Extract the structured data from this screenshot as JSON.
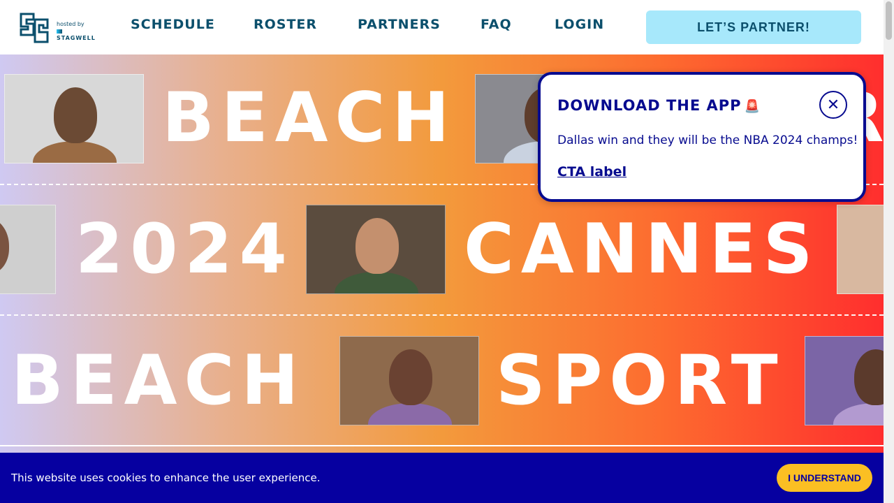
{
  "header": {
    "logo_alt": "SB",
    "hosted_by": "hosted by",
    "sponsor": "STAGWELL",
    "nav": [
      "SCHEDULE",
      "ROSTER",
      "PARTNERS",
      "FAQ",
      "LOGIN"
    ],
    "cta": "LET’S PARTNER!"
  },
  "hero": {
    "row1": [
      "BEACH",
      "R"
    ],
    "row2": [
      "2024",
      "CANNES"
    ],
    "row3": [
      "BEACH",
      "SPORT"
    ]
  },
  "popup": {
    "title": "DOWNLOAD THE APP",
    "icon": "siren-icon",
    "icon_glyph": "🚨",
    "body": "Dallas win and they will be the NBA 2024 champs!",
    "cta": "CTA label",
    "close_glyph": "✕"
  },
  "cookie": {
    "text": "This website uses cookies to enhance the user experience.",
    "button": "I UNDERSTAND"
  },
  "colors": {
    "brand_navy": "#0b4f6c",
    "popup_border": "#070b8f",
    "cookie_bg": "#0600a0",
    "cookie_button": "#fbbf23",
    "partner_button": "#a7e8fb"
  }
}
